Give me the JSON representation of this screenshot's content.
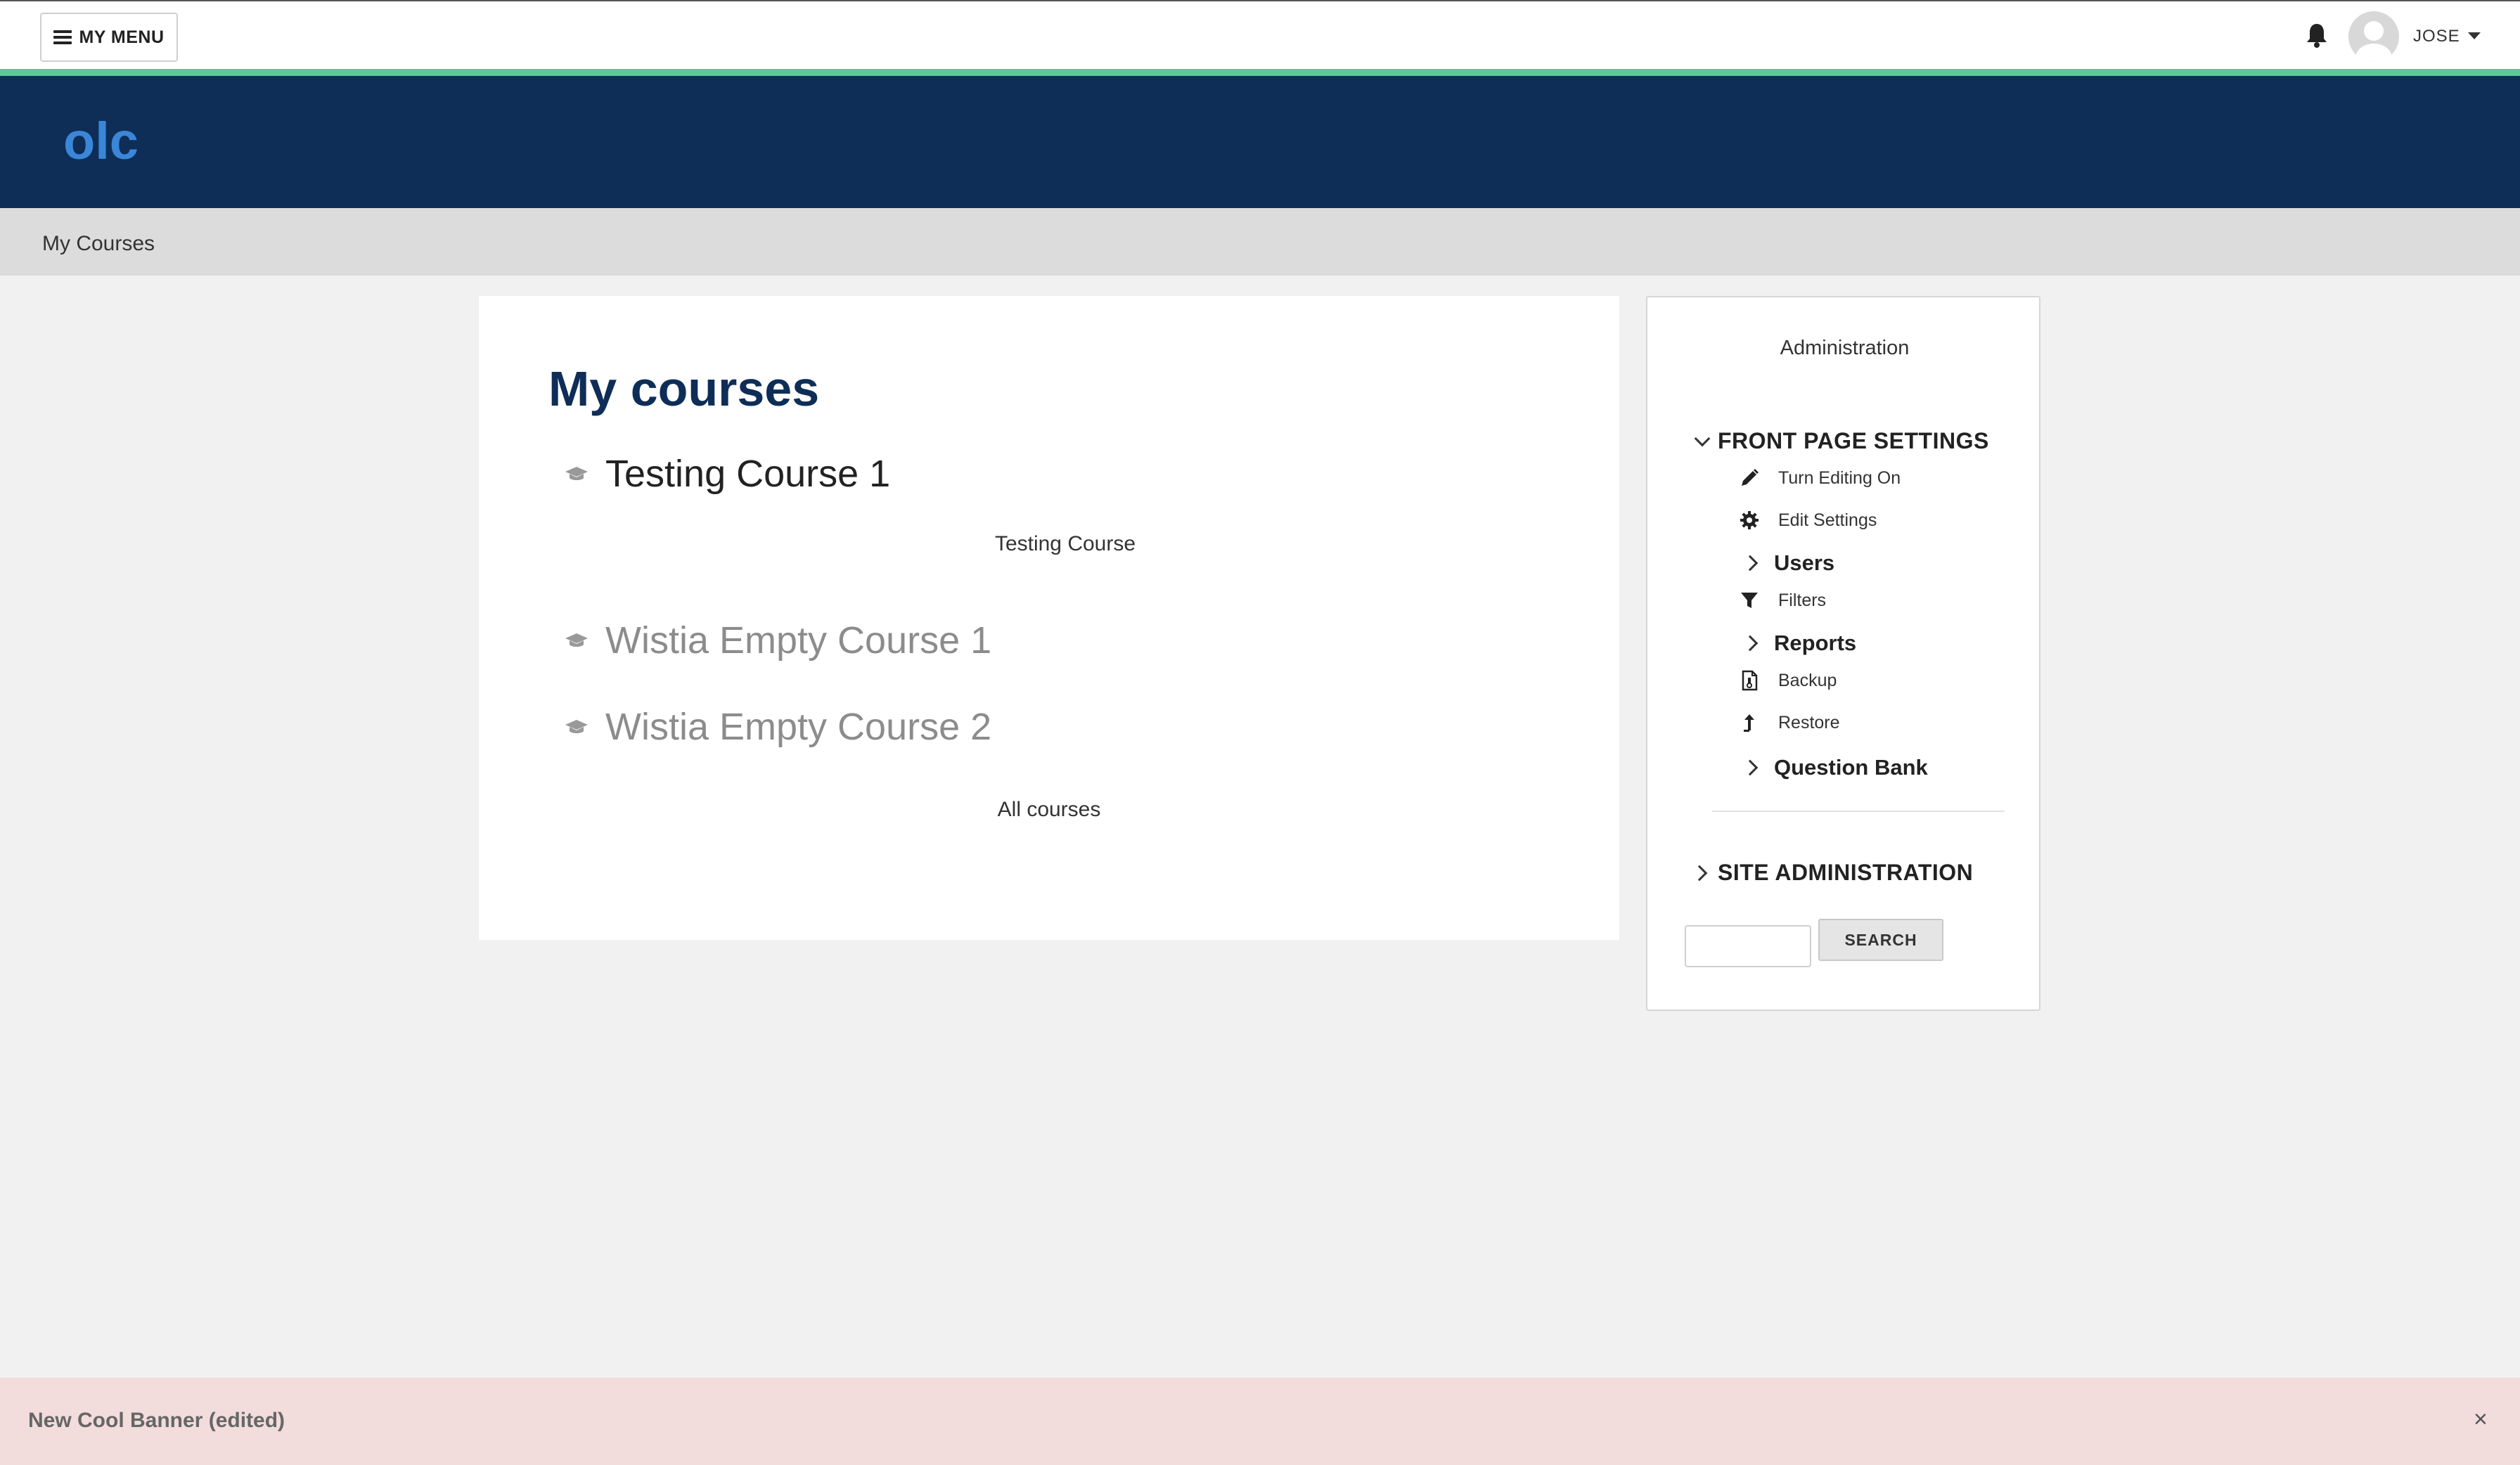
{
  "topbar": {
    "menu_label": "MY MENU",
    "username": "JOSE"
  },
  "header": {
    "logo": "olc"
  },
  "breadcrumb": {
    "items": [
      "My Courses"
    ]
  },
  "main": {
    "title": "My courses",
    "courses": [
      {
        "name": "Testing Course 1",
        "summary": "Testing Course"
      },
      {
        "name": "Wistia Empty Course 1"
      },
      {
        "name": "Wistia Empty Course 2"
      }
    ],
    "all_courses_link": "All courses"
  },
  "admin": {
    "title": "Administration",
    "front_page_settings": {
      "label": "FRONT PAGE SETTINGS",
      "items": [
        {
          "label": "Turn Editing On",
          "icon": "pencil-icon"
        },
        {
          "label": "Edit Settings",
          "icon": "gear-icon"
        },
        {
          "label": "Users",
          "icon": "chevron-right-icon"
        },
        {
          "label": "Filters",
          "icon": "filter-icon"
        },
        {
          "label": "Reports",
          "icon": "chevron-right-icon"
        },
        {
          "label": "Backup",
          "icon": "backup-file-icon"
        },
        {
          "label": "Restore",
          "icon": "upload-arrow-icon"
        },
        {
          "label": "Question Bank",
          "icon": "chevron-right-icon"
        }
      ]
    },
    "site_administration": {
      "label": "SITE ADMINISTRATION"
    },
    "search": {
      "button_label": "SEARCH",
      "value": ""
    }
  },
  "banner": {
    "text": "New Cool Banner (edited)",
    "close": "×"
  },
  "colors": {
    "header_bg": "#0e2e57",
    "logo": "#3a86d9",
    "accent_strip": "#5cc99a",
    "banner_bg": "#f2dcdc",
    "page_bg": "#f1f1f1"
  }
}
